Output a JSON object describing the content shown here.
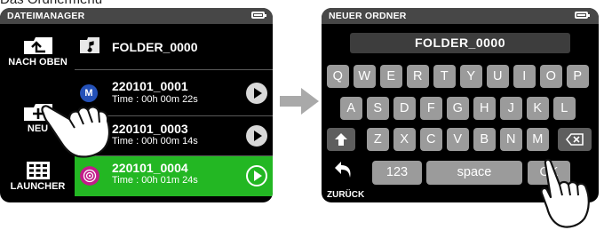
{
  "caption": "Das Ordnermenü",
  "left_screen": {
    "title": "DATEIMANAGER",
    "battery_level": 0.95,
    "side_buttons": [
      {
        "label": "NACH OBEN",
        "icon": "folder-up-icon"
      },
      {
        "label": "NEU",
        "icon": "plus-icon"
      },
      {
        "label": "LAUNCHER",
        "icon": "grid-icon"
      }
    ],
    "rows": [
      {
        "title": "FOLDER_0000",
        "icon": "music-folder-icon"
      },
      {
        "title": "220101_0001",
        "time": "Time : 00h 00m 22s",
        "badge": "M",
        "icon": "mono-badge-icon"
      },
      {
        "title": "220101_0003",
        "time": "Time : 00h 00m 14s",
        "icon": "stereo-badge-icon"
      },
      {
        "title": "220101_0004",
        "time": "Time : 00h 01m 24s",
        "icon": "ambisonic-badge-icon",
        "selected": true
      }
    ],
    "colors": {
      "selected_row": "#23b723",
      "mono_badge": "#2451b8",
      "ambisonic_badge": "#c21d8a"
    }
  },
  "right_screen": {
    "title": "NEUER ORDNER",
    "battery_level": 0.95,
    "folder_name": "FOLDER_0000",
    "keyboard": {
      "row1": [
        "Q",
        "W",
        "E",
        "R",
        "T",
        "Y",
        "U",
        "I",
        "O",
        "P"
      ],
      "row2": [
        "A",
        "S",
        "D",
        "F",
        "G",
        "H",
        "J",
        "K",
        "L"
      ],
      "row3": [
        "Z",
        "X",
        "C",
        "V",
        "B",
        "N",
        "M"
      ],
      "numbers_label": "123",
      "space_label": "space",
      "ok_label": "OK",
      "back_label": "ZURÜCK"
    }
  }
}
